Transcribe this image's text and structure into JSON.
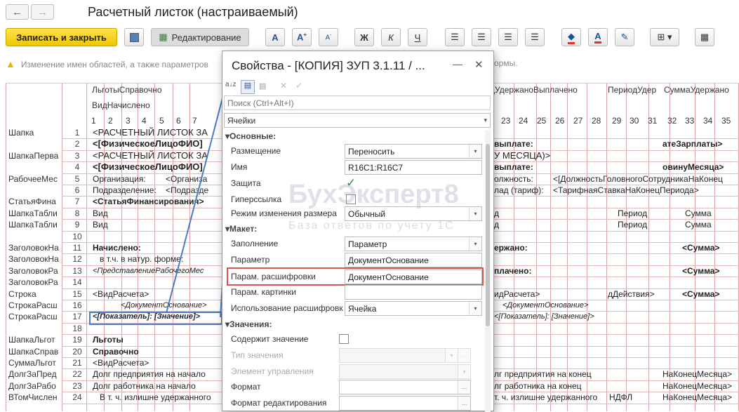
{
  "window": {
    "title": "Расчетный листок (настраиваемый)"
  },
  "toolbar": {
    "save_close": "Записать и закрыть",
    "edit_mode": "Редактирование",
    "bold": "Ж",
    "italic": "К",
    "underline": "Ч",
    "font_a": "A"
  },
  "notice": "Изменение имен областей, а также параметров",
  "notice_tail": "ормы.",
  "grid": {
    "top_labels": [
      {
        "key": "a",
        "text": "ЛьготыСправочно"
      },
      {
        "key": "b",
        "text": "ВидНачислено"
      },
      {
        "key": "c",
        "text": "дУдержаноВыплачено"
      },
      {
        "key": "d",
        "text": "ПериодУдер"
      },
      {
        "key": "e",
        "text": "СуммаУдержано"
      }
    ],
    "col_numbers": [
      "1",
      "2",
      "3",
      "4",
      "5",
      "6",
      "7"
    ],
    "col_numbers_right": [
      "23",
      "24",
      "25",
      "26",
      "27",
      "28",
      "29",
      "30",
      "31",
      "32",
      "33",
      "34",
      "35"
    ],
    "row_numbers": [
      "1",
      "2",
      "3",
      "4",
      "5",
      "6",
      "7",
      "8",
      "9",
      "10",
      "11",
      "12",
      "13",
      "14",
      "15",
      "16",
      "17",
      "18",
      "19",
      "20",
      "21",
      "22",
      "23",
      "24"
    ],
    "row_names": [
      "Шапка",
      "",
      "ШапкаПерва",
      "",
      "РабочееМес",
      "",
      "СтатьяФина",
      "ШапкаТабли",
      "ШапкаТабли",
      "",
      "ЗаголовокНа",
      "ЗаголовокНа",
      "ЗаголовокРа",
      "ЗаголовокРа",
      "Строка",
      "СтрокаРасш",
      "СтрокаРасш",
      "",
      "ШапкаЛьгот",
      "ШапкаСправ",
      "СуммаЛьгот",
      "ДолгЗаПред",
      "ДолгЗаРабо",
      "ВТомЧислен"
    ],
    "left_cells": [
      "<РАСЧЕТНЫЙ ЛИСТОК ЗА",
      "<[ФизическоеЛицоФИО]",
      "<РАСЧЕТНЫЙ ЛИСТОК ЗА",
      "<[ФизическоеЛицоФИО]",
      "Организация:",
      "Подразделение:",
      "<СтатьяФинансирования>",
      "Вид",
      "Вид",
      "",
      "Начислено:",
      "в т.ч. в натур. форме:",
      "<ПредставлениеРабочегоМес",
      "",
      "<ВидРасчета>",
      "<ДокументОснование>",
      "<[Показатель]: [Значение]>",
      "",
      "Льготы",
      "Справочно",
      "<ВидРасчета>",
      "Долг предприятия на начало",
      "Долг работника на начало",
      "В т. ч. излишне удержанного"
    ],
    "left_cells2": [
      "",
      "",
      "",
      "",
      "<Организа",
      "<Подразде",
      "",
      "",
      "",
      "",
      "",
      "",
      "",
      "",
      "",
      "",
      "",
      "",
      "",
      "",
      "",
      "",
      "",
      ""
    ],
    "right_cells": [
      "",
      "выплате:",
      "У МЕСЯЦА)>",
      "выплате:",
      "олжность:",
      "лад (тариф):",
      "",
      "д",
      "д",
      "",
      "ержано:",
      "",
      "плачено:",
      "",
      "идРасчета>",
      "<ДокументОснование>",
      "<[Показатель]: [Значение]>",
      "",
      "",
      "",
      "",
      "лг предприятия на конец",
      "лг работника на конец",
      "т. ч. излишне удержанного"
    ],
    "right_cells2": [
      "",
      "",
      "",
      "",
      "<[ДолжностьГоловногоСотрудникаНаКонец",
      "<ТарифнаяСтавкаНаКонецПериода>",
      "",
      "Период",
      "Период",
      "",
      "",
      "",
      "",
      "",
      "дДействия>",
      "",
      "",
      "",
      "",
      "",
      "",
      "",
      "",
      ""
    ],
    "right_cells3": [
      "",
      "атеЗарплаты>",
      "",
      "овинуМесяца>",
      "",
      "",
      "",
      "Сумма",
      "Сумма",
      "",
      "<Сумма>",
      "",
      "<Сумма>",
      "",
      "<Сумма>",
      "",
      "",
      "",
      "",
      "",
      "",
      "НаКонецМесяца>",
      "НаКонецМесяца>",
      "НаКонецМесяца>"
    ],
    "right_cells_ndfl": [
      "",
      "",
      "",
      "",
      "",
      "",
      "",
      "",
      "",
      "",
      "",
      "",
      "",
      "",
      "",
      "",
      "",
      "",
      "",
      "",
      "",
      "",
      "",
      "НДФЛ"
    ]
  },
  "dialog": {
    "title": "Свойства - [КОПИЯ] ЗУП 3.1.11 / ...",
    "minimize": "—",
    "close": "✕",
    "search_placeholder": "Поиск (Ctrl+Alt+I)",
    "object_type": "Ячейки",
    "sections": {
      "main": "Основные:",
      "layout": "Макет:",
      "values": "Значения:"
    },
    "props": {
      "placement": {
        "label": "Размещение",
        "value": "Переносить"
      },
      "name": {
        "label": "Имя",
        "value": "R16C1:R16C7"
      },
      "protection": {
        "label": "Защита"
      },
      "hyperlink": {
        "label": "Гиперссылка"
      },
      "size_mode": {
        "label": "Режим изменения размера",
        "value": "Обычный"
      },
      "fill": {
        "label": "Заполнение",
        "value": "Параметр"
      },
      "parameter": {
        "label": "Параметр",
        "value": "ДокументОснование"
      },
      "decode_param": {
        "label": "Парам. расшифровки",
        "value": "ДокументОснование"
      },
      "picture_param": {
        "label": "Парам. картинки",
        "value": ""
      },
      "decode_use": {
        "label": "Использование расшифровки",
        "value": "Ячейка"
      },
      "contains_value": {
        "label": "Содержит значение"
      },
      "value_type": {
        "label": "Тип значения",
        "value": ""
      },
      "control": {
        "label": "Элемент управления",
        "value": ""
      },
      "format": {
        "label": "Формат",
        "value": ""
      },
      "edit_format": {
        "label": "Формат редактирования",
        "value": ""
      }
    }
  },
  "watermark": {
    "brand": "БухЭксперт8",
    "tagline": "База ответов по учету 1С"
  },
  "colors": {
    "accent_red": "#d9534f",
    "highlight_blue": "#4a7cc7",
    "yellow": "#f2c500"
  }
}
